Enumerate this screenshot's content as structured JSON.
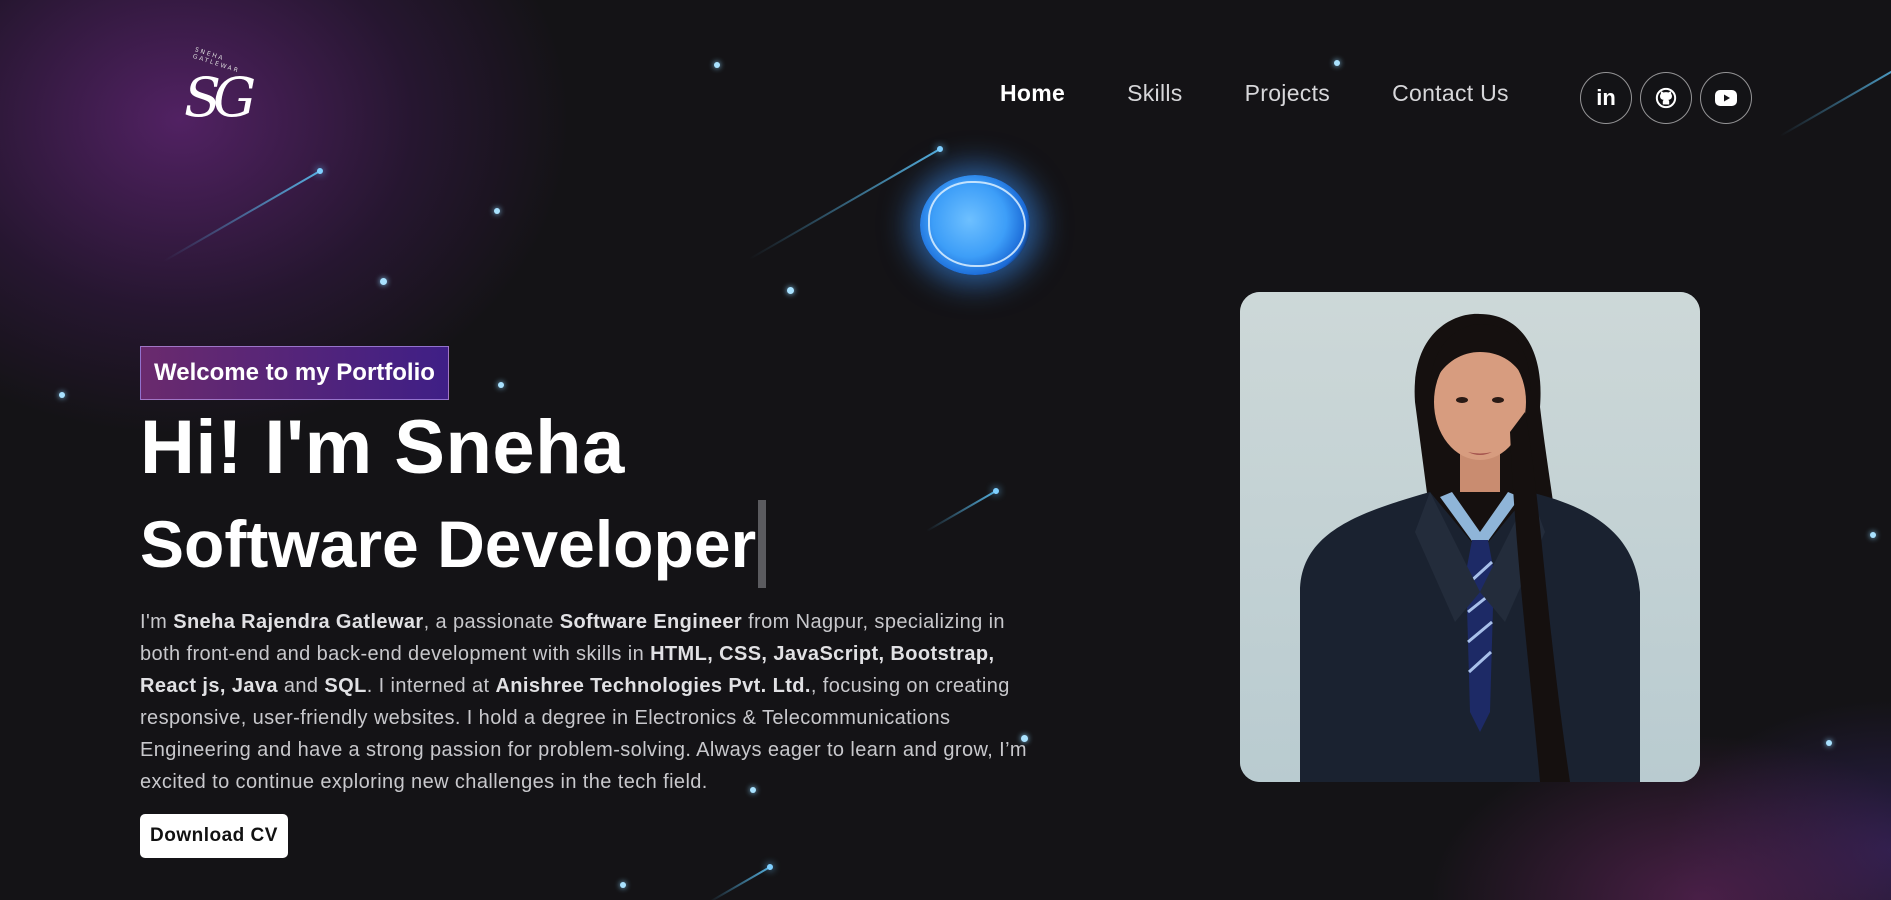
{
  "logo": {
    "monogram": "SG",
    "arc_text": "SNEHA GATLEWAR"
  },
  "nav": {
    "items": [
      {
        "label": "Home",
        "active": true
      },
      {
        "label": "Skills"
      },
      {
        "label": "Projects"
      },
      {
        "label": "Contact Us"
      }
    ]
  },
  "socials": [
    {
      "icon": "linkedin-icon",
      "label": "in"
    },
    {
      "icon": "github-icon"
    },
    {
      "icon": "youtube-icon"
    }
  ],
  "hero": {
    "welcome": "Welcome to my Portfolio",
    "greeting": "Hi! I'm Sneha",
    "role": "Software Developer",
    "bio": {
      "p1": "I'm ",
      "name": "Sneha Rajendra Gatlewar",
      "p2": ", a passionate ",
      "title": "Software Engineer",
      "p3": " from Nagpur, specializing in both front-end and back-end development with skills in ",
      "skills": "HTML, CSS, JavaScript, Bootstrap, React js, Java",
      "p4": " and ",
      "sql": "SQL",
      "p5": ". I interned at ",
      "company": "Anishree Technologies Pvt. Ltd.",
      "p6": ", focusing on creating responsive, user-friendly websites. I hold a degree in Electronics & Telecommunications Engineering and have a strong passion for problem-solving. Always eager to learn and grow, I’m excited to continue exploring new challenges in the tech field."
    },
    "download_label": "Download CV"
  },
  "colors": {
    "background": "#141316",
    "welcome_gradient_start": "#6a2a6d",
    "welcome_gradient_end": "#3f1f86",
    "accent_blue": "#3d9ef8"
  }
}
